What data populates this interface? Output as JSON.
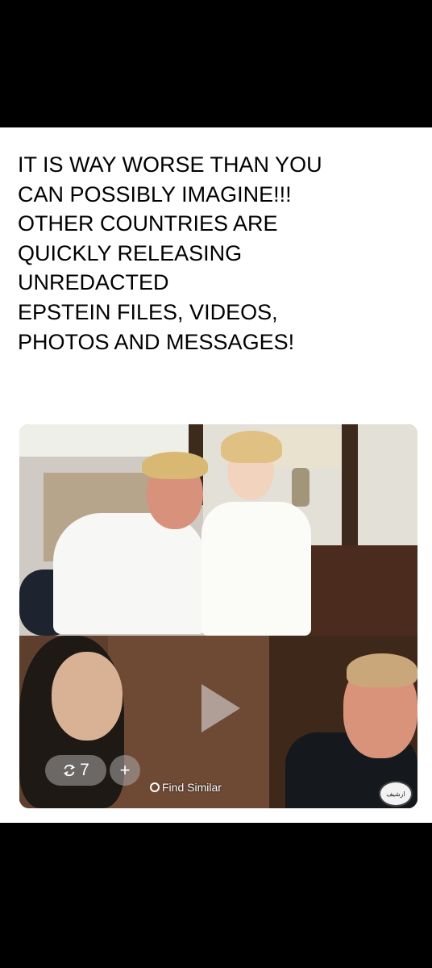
{
  "post": {
    "caption_lines": [
      "IT IS WAY WORSE THAN YOU",
      "CAN POSSIBLY IMAGINE!!!",
      "OTHER COUNTRIES ARE",
      "QUICKLY RELEASING",
      "UNREDACTED",
      "EPSTEIN FILES, VIDEOS,",
      "PHOTOS AND MESSAGES!"
    ]
  },
  "media": {
    "repost_count": "7",
    "add_label": "+",
    "find_similar_label": "Find Similar",
    "watermark_logo": "ارشيف"
  },
  "colors": {
    "page_bg": "#000000",
    "card_bg": "#ffffff",
    "caption_text": "#000000"
  },
  "icons": {
    "play": "play-icon",
    "repost": "repost-icon",
    "add": "add-icon",
    "find": "find-similar-icon"
  }
}
